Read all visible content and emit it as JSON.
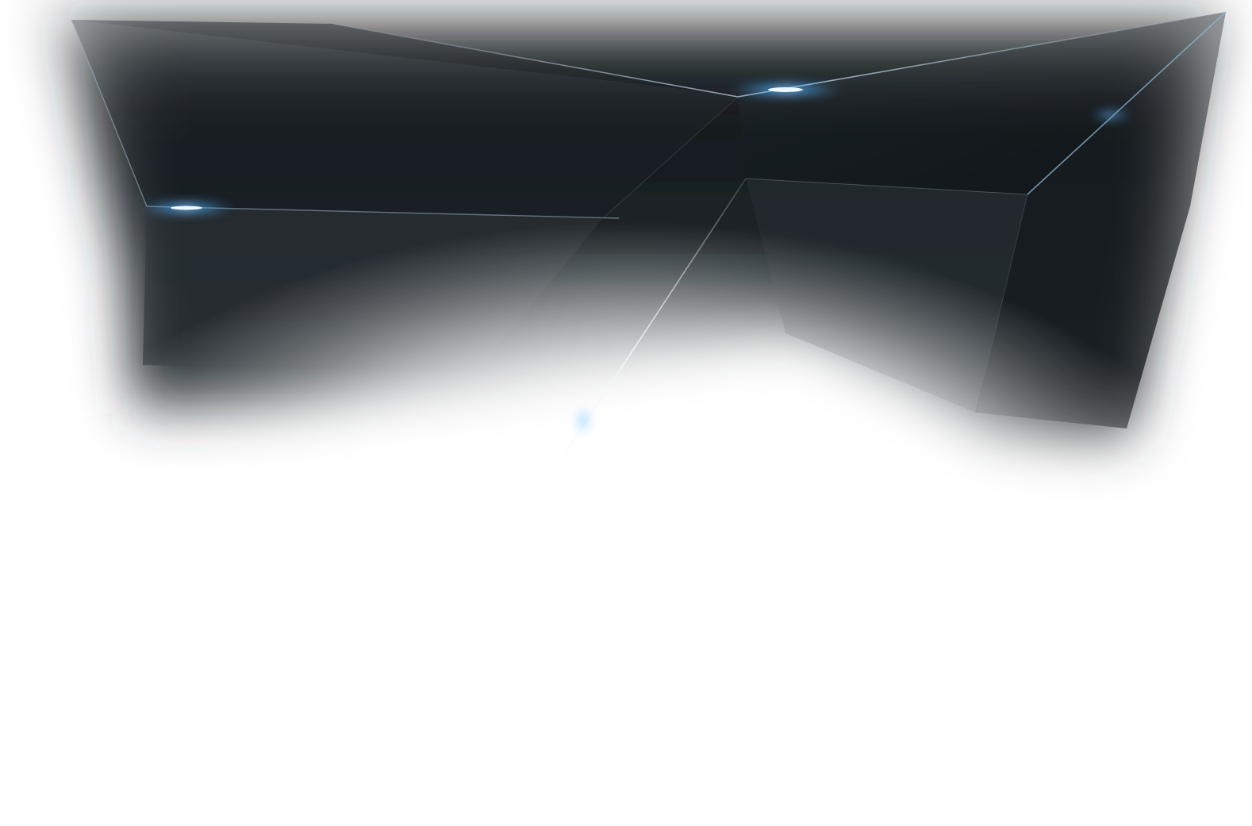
{
  "image": {
    "description_role": "decorative-background",
    "colors": {
      "background": "#ffffff",
      "dark_panel": "#12181c",
      "mid_panel": "#232a2f",
      "edge_highlight": "#8fb9d6",
      "glow_accent": "#4fb2ff"
    }
  }
}
